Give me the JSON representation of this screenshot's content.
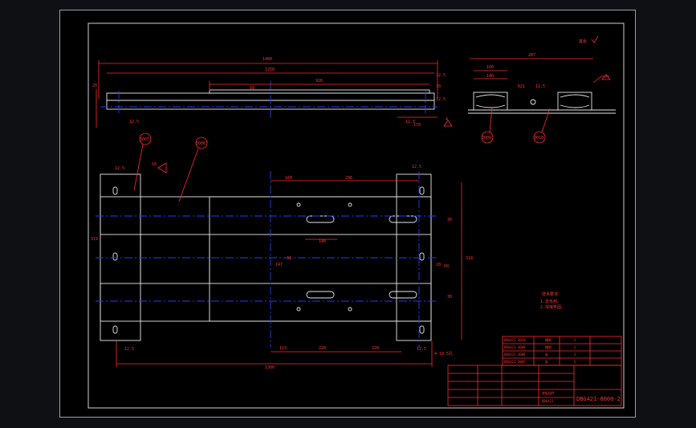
{
  "drawing": {
    "stamp": "其余",
    "dims_top": {
      "overall_length": "1480",
      "inner_length": "1258",
      "span": "926",
      "small_a": "10",
      "small_b": "8",
      "left_height": "20",
      "right_h1": "12.5",
      "right_h2": "10",
      "right_h3": "12.5",
      "bottom_left": "12.5",
      "bottom_right": "12.5",
      "angle": "4",
      "tol_left": "12.5",
      "tol_right": "12.5",
      "dim_170": "170"
    },
    "dims_section": {
      "width": "287",
      "w1": "160",
      "w2": "140",
      "w3": "R21",
      "w4": "12.5"
    },
    "balloons": [
      "3007",
      "3008",
      "3009",
      "3010"
    ],
    "dims_plan": {
      "left_a": "12.5",
      "left_b": "10",
      "right_a": "12.5",
      "d160": "160",
      "d296": "296",
      "d140": "140",
      "d30a": "30",
      "d30b": "30",
      "d20": "20",
      "d31": "31",
      "d147": "147",
      "d318": "318",
      "d60": "60",
      "left_height": "319",
      "bottom_a": "123",
      "bottom_b": "220",
      "bottom_c": "220",
      "overall": "1300",
      "hole_note": "4-10.5孔",
      "bl": "12.5",
      "br": "12.5"
    },
    "tech": {
      "title": "技术要求",
      "line1": "1.去毛刺。",
      "line2": "2.焊接牢固。"
    },
    "title_block": {
      "drawing_no": "DBG421-0000-2",
      "name_main": "底板组件",
      "part_code": "DBG421",
      "rows": [
        {
          "code": "DBG421-3010",
          "qty": "2",
          "name": "槽钢"
        },
        {
          "code": "DBG421-3009",
          "qty": "2",
          "name": "槽钢"
        },
        {
          "code": "DBG421-3008",
          "qty": "2",
          "name": "板"
        },
        {
          "code": "DBG421-3007",
          "qty": "2",
          "name": "板"
        }
      ]
    }
  }
}
